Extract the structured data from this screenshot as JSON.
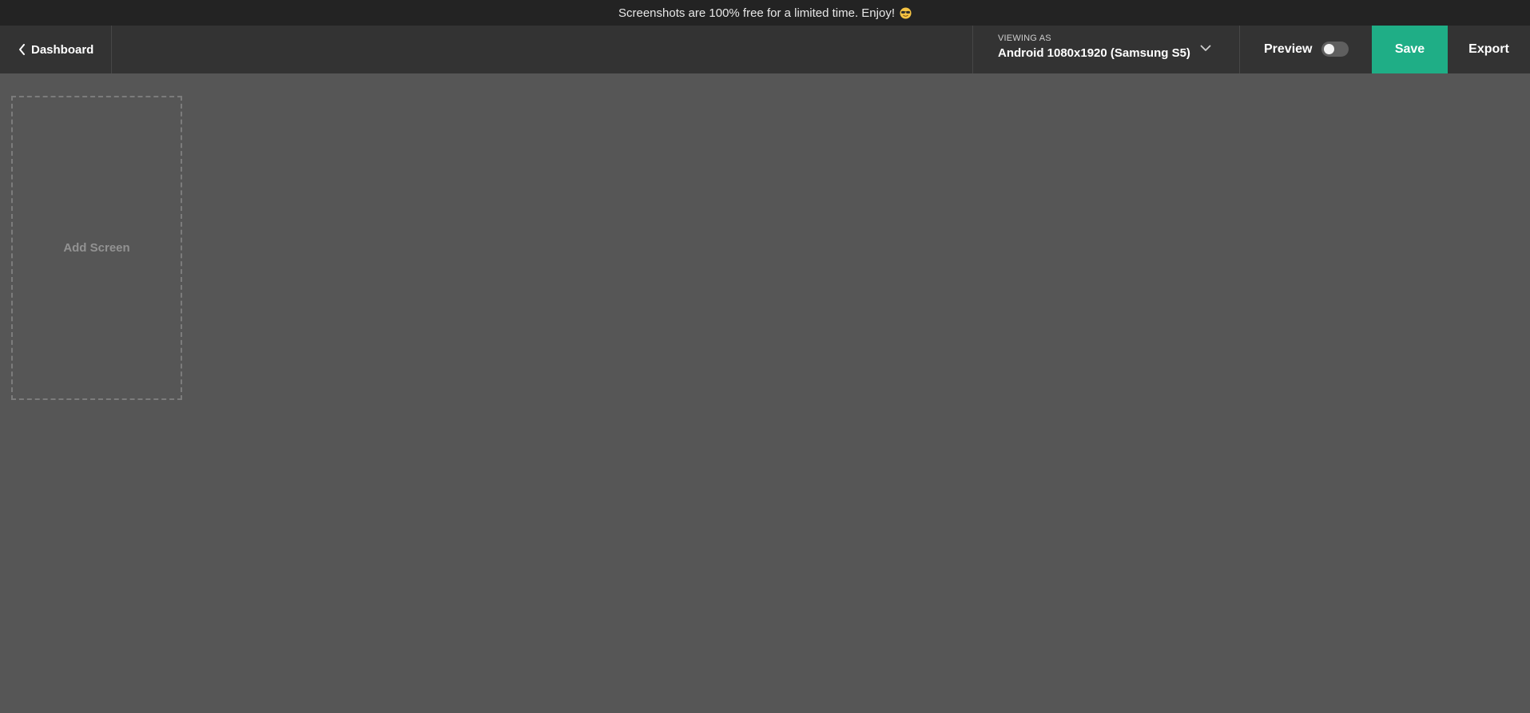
{
  "banner": {
    "text": "Screenshots are 100% free for a limited time. Enjoy!",
    "icon": "sunglasses-emoji-icon"
  },
  "topbar": {
    "back_label": "Dashboard",
    "back_icon": "chevron-left-icon",
    "device": {
      "caption": "VIEWING AS",
      "selected": "Android 1080x1920 (Samsung S5)",
      "icon": "chevron-down-icon"
    },
    "preview": {
      "label": "Preview",
      "enabled": false
    },
    "save_label": "Save",
    "export_label": "Export"
  },
  "canvas": {
    "add_screen_label": "Add Screen"
  },
  "colors": {
    "accent": "#1fae86",
    "topbar": "#333333",
    "banner": "#232323",
    "canvas": "#565656"
  }
}
